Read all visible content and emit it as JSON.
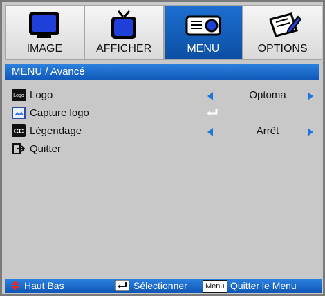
{
  "tabs": [
    {
      "label": "IMAGE",
      "icon": "monitor-icon",
      "active": false
    },
    {
      "label": "AFFICHER",
      "icon": "tv-icon",
      "active": false
    },
    {
      "label": "MENU",
      "icon": "projector-icon",
      "active": true
    },
    {
      "label": "OPTIONS",
      "icon": "settings-pencil-icon",
      "active": false
    }
  ],
  "breadcrumb": "MENU / Avancé",
  "menu": {
    "logo": {
      "label": "Logo",
      "value": "Optoma",
      "icon_text": "Logo"
    },
    "capture": {
      "label": "Capture logo"
    },
    "caption": {
      "label": "Légendage",
      "value": "Arrêt",
      "icon_text": "CC"
    },
    "exit": {
      "label": "Quitter"
    }
  },
  "footer": {
    "navigate": "Haut Bas",
    "select": "Sélectionner",
    "menu_key": "Menu",
    "exit": "Quitter le Menu"
  },
  "colors": {
    "accent_blue": "#0f57b6",
    "arrow_blue": "#1c76dc",
    "footer_arrow_red": "#e12b2b",
    "panel_gray": "#c8c8c8"
  }
}
